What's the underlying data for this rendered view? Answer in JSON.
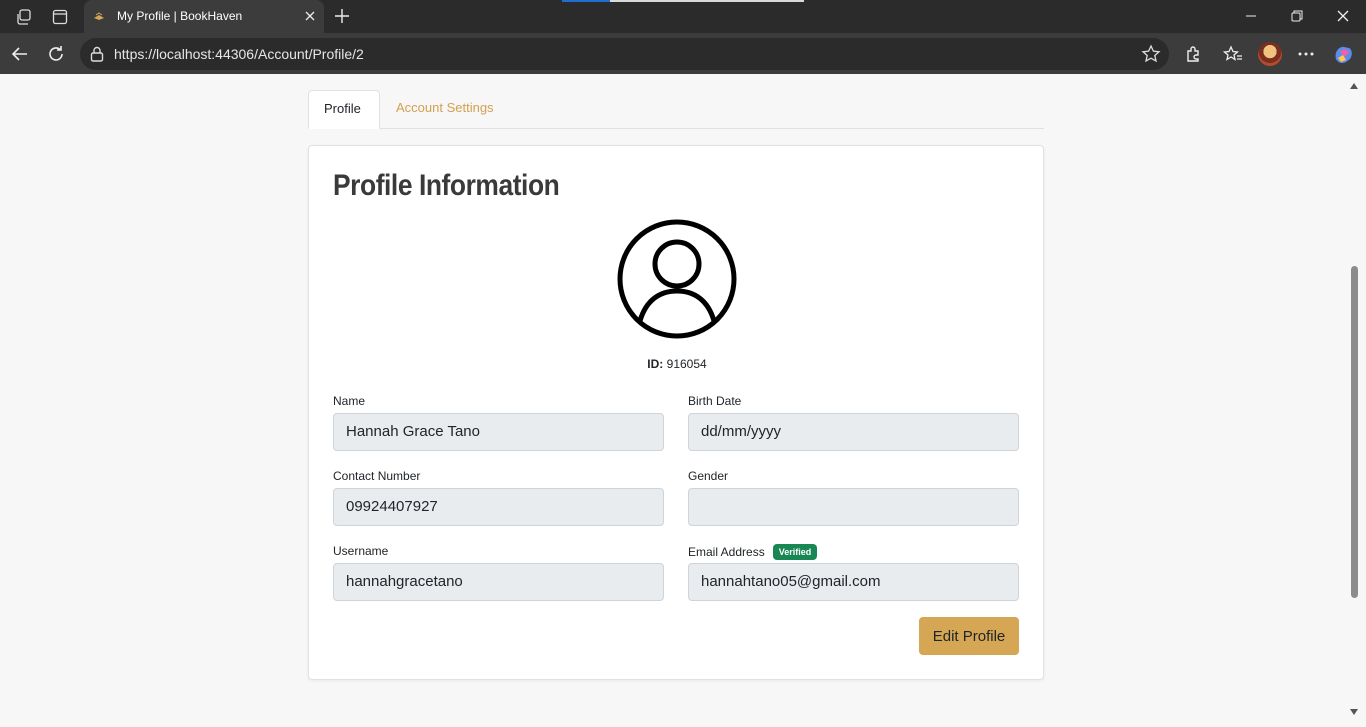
{
  "browser": {
    "tab_title": "My Profile | BookHaven",
    "url": "https://localhost:44306/Account/Profile/2"
  },
  "page": {
    "tabs": [
      {
        "label": "Profile",
        "active": true
      },
      {
        "label": "Account Settings",
        "active": false
      }
    ],
    "card_title": "Profile Information",
    "id_label": "ID:",
    "id_value": "916054",
    "fields": {
      "name": {
        "label": "Name",
        "value": "Hannah Grace Tano"
      },
      "birth_date": {
        "label": "Birth Date",
        "value": "dd/mm/yyyy"
      },
      "contact": {
        "label": "Contact Number",
        "value": "09924407927"
      },
      "gender": {
        "label": "Gender",
        "value": ""
      },
      "username": {
        "label": "Username",
        "value": "hannahgracetano"
      },
      "email": {
        "label": "Email Address",
        "value": "hannahtano05@gmail.com",
        "badge": "Verified"
      }
    },
    "edit_button": "Edit Profile"
  },
  "colors": {
    "accent": "#d5a654",
    "link": "#d4a04f",
    "badge_green": "#198754"
  }
}
